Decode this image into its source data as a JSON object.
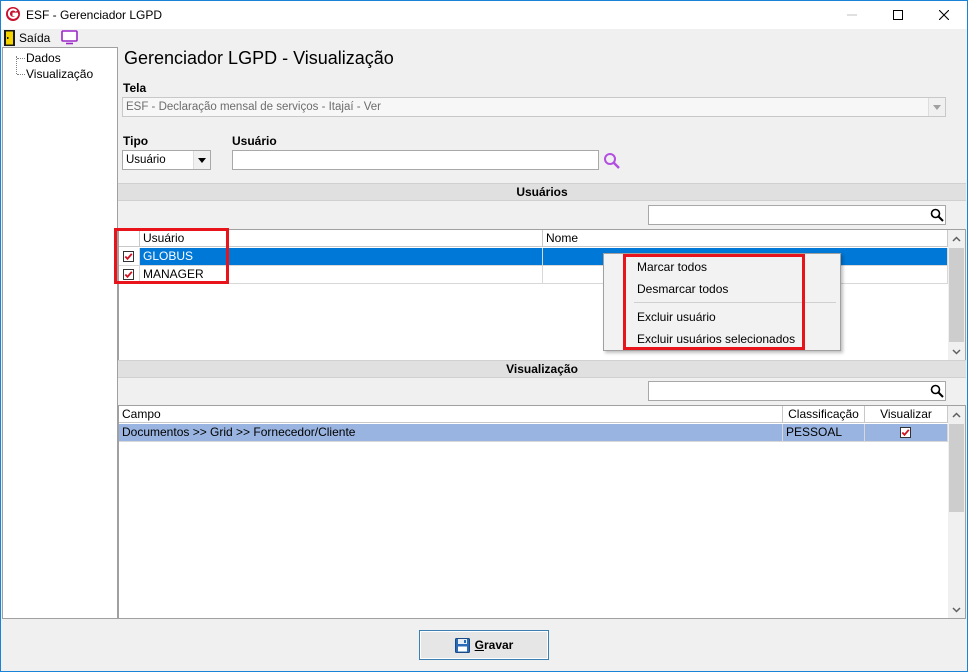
{
  "window": {
    "title": "ESF - Gerenciador LGPD"
  },
  "menu": {
    "exit_label": "Saída"
  },
  "tree": {
    "items": [
      {
        "label": "Dados"
      },
      {
        "label": "Visualização"
      }
    ]
  },
  "page": {
    "title": "Gerenciador LGPD - Visualização"
  },
  "form": {
    "tela_label": "Tela",
    "tela_value": "ESF - Declaração mensal de serviços - Itajaí - Ver",
    "tipo_label": "Tipo",
    "tipo_value": "Usuário",
    "usuario_label": "Usuário",
    "usuario_value": ""
  },
  "users_section": {
    "title": "Usuários",
    "filter_value": "",
    "columns": [
      "Usuário",
      "Nome"
    ],
    "rows": [
      {
        "checked": true,
        "usuario": "GLOBUS",
        "nome": "",
        "selected": true
      },
      {
        "checked": true,
        "usuario": "MANAGER",
        "nome": "",
        "selected": false
      }
    ]
  },
  "context_menu": {
    "items": [
      "Marcar todos",
      "Desmarcar todos",
      "Excluir usuário",
      "Excluir usuários selecionados"
    ]
  },
  "view_section": {
    "title": "Visualização",
    "filter_value": "",
    "columns": [
      "Campo",
      "Classificação",
      "Visualizar"
    ],
    "rows": [
      {
        "campo": "Documentos >> Grid >> Fornecedor/Cliente",
        "classificacao": "PESSOAL",
        "visualizar": true
      }
    ]
  },
  "footer": {
    "save_label_first": "G",
    "save_label_rest": "ravar"
  },
  "colors": {
    "selection": "#0078d7",
    "highlight_row": "#99b4e0",
    "annotation": "#e8141c"
  }
}
